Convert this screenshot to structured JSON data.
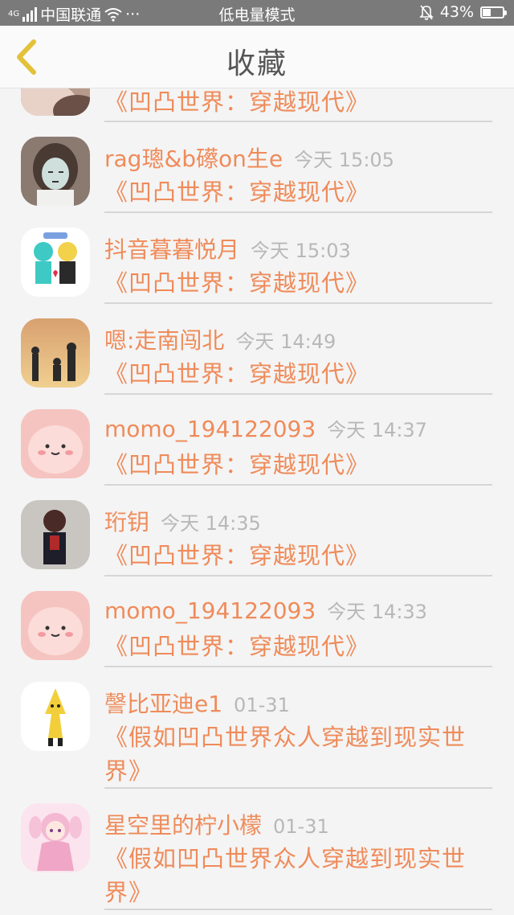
{
  "status_bar": {
    "carrier": "中国联通",
    "dots": "···",
    "mode": "低电量模式",
    "battery": "43%",
    "battery_level": 0.43,
    "signal_type": "4G"
  },
  "nav": {
    "title": "收藏",
    "back_icon": "chevron-left-icon"
  },
  "colors": {
    "accent": "#ef8b5a",
    "time": "#b8b8b8",
    "back_icon": "#e3c23a"
  },
  "items": [
    {
      "username": "",
      "time": "",
      "novel": "《凹凸世界：穿越现代》",
      "avatar": "partial-photo"
    },
    {
      "username": "rag璁&b礤on生e",
      "time": "今天 15:05",
      "novel": "《凹凸世界：穿越现代》",
      "avatar": "cartoon-girl"
    },
    {
      "username": "抖音暮暮悦月",
      "time": "今天 15:03",
      "novel": "《凹凸世界：穿越现代》",
      "avatar": "anime-pair"
    },
    {
      "username": "嗯:走南闯北",
      "time": "今天 14:49",
      "novel": "《凹凸世界：穿越现代》",
      "avatar": "sunset-silhouettes"
    },
    {
      "username": "momo_194122093",
      "time": "今天 14:37",
      "novel": "《凹凸世界：穿越现代》",
      "avatar": "pink-blob"
    },
    {
      "username": "珩钥",
      "time": "今天 14:35",
      "novel": "《凹凸世界：穿越现代》",
      "avatar": "dark-figure"
    },
    {
      "username": "momo_194122093",
      "time": "今天 14:33",
      "novel": "《凹凸世界：穿越现代》",
      "avatar": "pink-blob"
    },
    {
      "username": "謦比亚迪e1",
      "time": "01-31",
      "novel": "《假如凹凸世界众人穿越到现实世界》",
      "avatar": "yellow-character"
    },
    {
      "username": "星空里的柠小檬",
      "time": "01-31",
      "novel": "《假如凹凸世界众人穿越到现实世界》",
      "avatar": "pink-anime-girl"
    }
  ]
}
